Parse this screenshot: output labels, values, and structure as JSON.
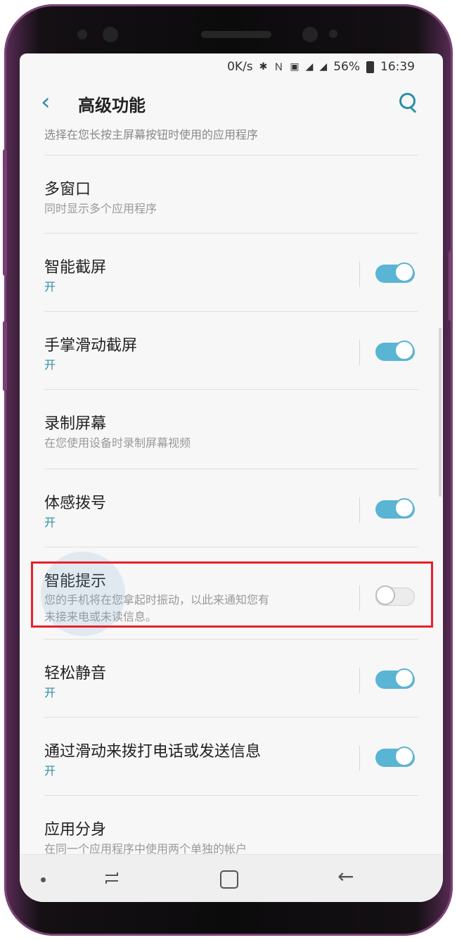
{
  "status_bar": {
    "net_speed": "0K/s",
    "icons": [
      "bluetooth-icon",
      "nfc-icon",
      "vibrate-icon",
      "signal-icon",
      "signal-icon"
    ],
    "battery_percent": "56%",
    "time": "16:39"
  },
  "header": {
    "title": "高级功能",
    "back_icon": "chevron-left-icon",
    "search_icon": "search-icon"
  },
  "cutoff_text": "选择在您长按主屏幕按钮时使用的应用程序",
  "settings": [
    {
      "title": "多窗口",
      "subtitle": "同时显示多个应用程序",
      "has_toggle": false
    },
    {
      "title": "智能截屏",
      "subtitle": "开",
      "has_toggle": true,
      "toggle_on": true
    },
    {
      "title": "手掌滑动截屏",
      "subtitle": "开",
      "has_toggle": true,
      "toggle_on": true
    },
    {
      "title": "录制屏幕",
      "subtitle": "在您使用设备时录制屏幕视频",
      "has_toggle": false
    },
    {
      "title": "体感拨号",
      "subtitle": "开",
      "has_toggle": true,
      "toggle_on": true
    },
    {
      "title": "智能提示",
      "subtitle_line1": "您的手机将在您拿起时振动，以此来通知您有",
      "subtitle_line2": "未接来电或未读信息。",
      "has_toggle": true,
      "toggle_on": false
    },
    {
      "title": "轻松静音",
      "subtitle": "开",
      "has_toggle": true,
      "toggle_on": true
    },
    {
      "title": "通过滑动来拨打电话或发送信息",
      "subtitle": "开",
      "has_toggle": true,
      "toggle_on": true
    },
    {
      "title": "应用分身",
      "subtitle": "在同一个应用程序中使用两个单独的帐户",
      "has_toggle": false
    }
  ],
  "colors": {
    "accent": "#2b8ea8",
    "toggle_on": "#5ab4d4",
    "highlight_border": "#e8202c"
  },
  "nav_bar": {
    "icons": [
      "dot-icon",
      "recent-apps-icon",
      "home-icon",
      "back-arrow-icon"
    ]
  }
}
